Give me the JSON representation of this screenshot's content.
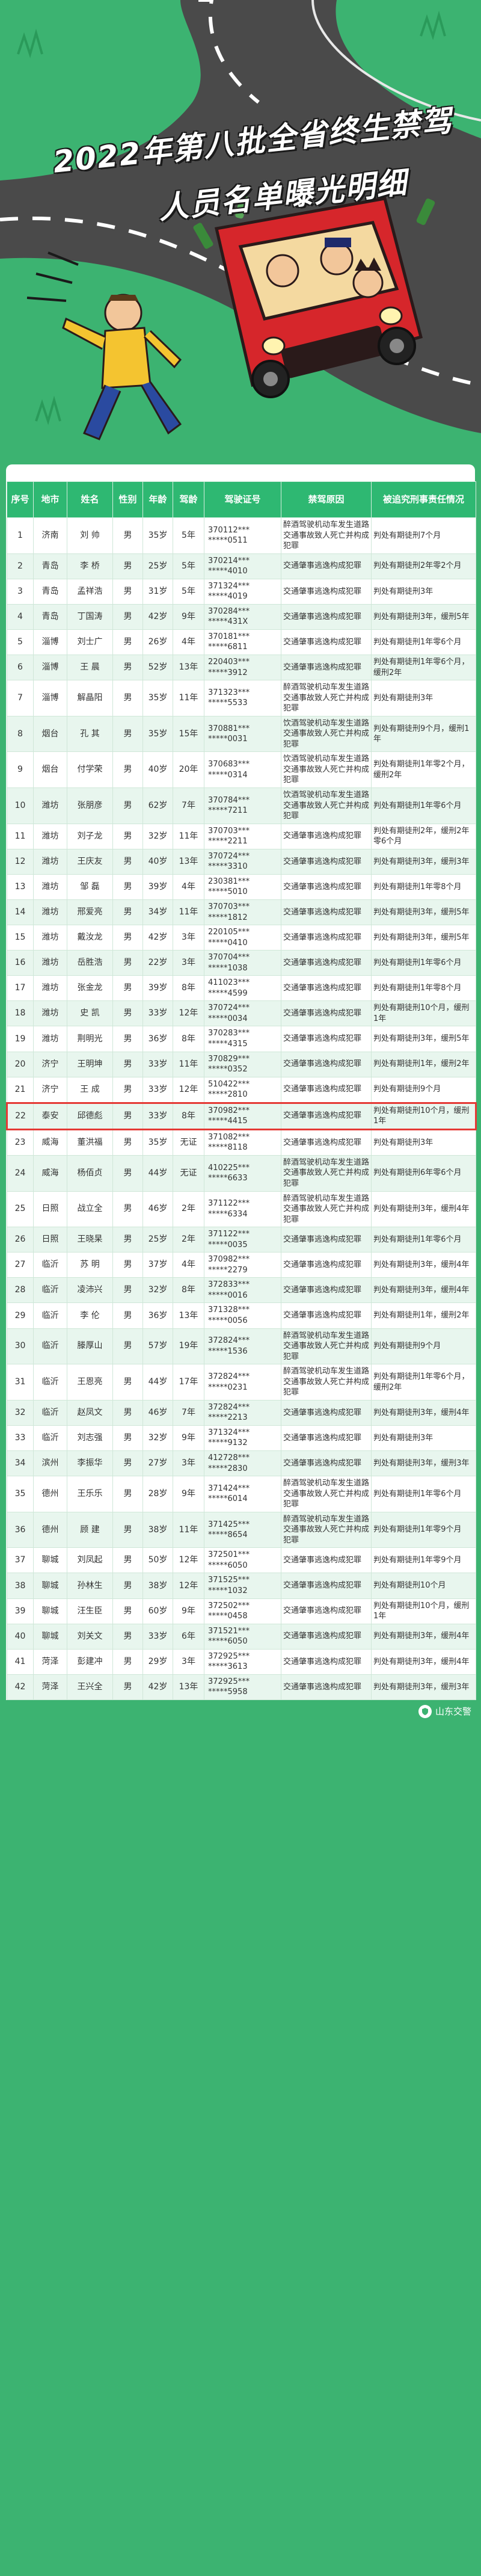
{
  "banner": {
    "title_line1": "2022年第八批全省终生禁驾",
    "title_line2": "人员名单曝光明细"
  },
  "table": {
    "headers": [
      "序号",
      "地市",
      "姓名",
      "性别",
      "年龄",
      "驾龄",
      "驾驶证号",
      "禁驾原因",
      "被追究刑事责任情况"
    ],
    "rows": [
      [
        "1",
        "济南",
        "刘 帅",
        "男",
        "35岁",
        "5年",
        "370112*** *****0511",
        "醉酒驾驶机动车发生道路交通事故致人死亡并构成犯罪",
        "判处有期徒刑7个月"
      ],
      [
        "2",
        "青岛",
        "李 桥",
        "男",
        "25岁",
        "5年",
        "370214*** *****4010",
        "交通肇事逃逸构成犯罪",
        "判处有期徒刑2年零2个月"
      ],
      [
        "3",
        "青岛",
        "孟祥浩",
        "男",
        "31岁",
        "5年",
        "371324*** *****4019",
        "交通肇事逃逸构成犯罪",
        "判处有期徒刑3年"
      ],
      [
        "4",
        "青岛",
        "丁国涛",
        "男",
        "42岁",
        "9年",
        "370284*** *****431X",
        "交通肇事逃逸构成犯罪",
        "判处有期徒刑3年，缓刑5年"
      ],
      [
        "5",
        "淄博",
        "刘士广",
        "男",
        "26岁",
        "4年",
        "370181*** *****6811",
        "交通肇事逃逸构成犯罪",
        "判处有期徒刑1年零6个月"
      ],
      [
        "6",
        "淄博",
        "王 晨",
        "男",
        "52岁",
        "13年",
        "220403*** *****3912",
        "交通肇事逃逸构成犯罪",
        "判处有期徒刑1年零6个月，缓刑2年"
      ],
      [
        "7",
        "淄博",
        "解晶阳",
        "男",
        "35岁",
        "11年",
        "371323*** *****5533",
        "醉酒驾驶机动车发生道路交通事故致人死亡并构成犯罪",
        "判处有期徒刑3年"
      ],
      [
        "8",
        "烟台",
        "孔 其",
        "男",
        "35岁",
        "15年",
        "370881*** *****0031",
        "饮酒驾驶机动车发生道路交通事故致人死亡并构成犯罪",
        "判处有期徒刑9个月，缓刑1年"
      ],
      [
        "9",
        "烟台",
        "付学荣",
        "男",
        "40岁",
        "20年",
        "370683*** *****0314",
        "饮酒驾驶机动车发生道路交通事故致人死亡并构成犯罪",
        "判处有期徒刑1年零2个月，缓刑2年"
      ],
      [
        "10",
        "潍坊",
        "张朋彦",
        "男",
        "62岁",
        "7年",
        "370784*** *****7211",
        "饮酒驾驶机动车发生道路交通事故致人死亡并构成犯罪",
        "判处有期徒刑1年零6个月"
      ],
      [
        "11",
        "潍坊",
        "刘子龙",
        "男",
        "32岁",
        "11年",
        "370703*** *****2211",
        "交通肇事逃逸构成犯罪",
        "判处有期徒刑2年，缓刑2年零6个月"
      ],
      [
        "12",
        "潍坊",
        "王庆友",
        "男",
        "40岁",
        "13年",
        "370724*** *****3310",
        "交通肇事逃逸构成犯罪",
        "判处有期徒刑3年，缓刑3年"
      ],
      [
        "13",
        "潍坊",
        "邹 磊",
        "男",
        "39岁",
        "4年",
        "230381*** *****5010",
        "交通肇事逃逸构成犯罪",
        "判处有期徒刑1年零8个月"
      ],
      [
        "14",
        "潍坊",
        "邢爱亮",
        "男",
        "34岁",
        "11年",
        "370703*** *****1812",
        "交通肇事逃逸构成犯罪",
        "判处有期徒刑3年，缓刑5年"
      ],
      [
        "15",
        "潍坊",
        "戴汝龙",
        "男",
        "42岁",
        "3年",
        "220105*** *****0410",
        "交通肇事逃逸构成犯罪",
        "判处有期徒刑3年，缓刑5年"
      ],
      [
        "16",
        "潍坊",
        "岳胜浩",
        "男",
        "22岁",
        "3年",
        "370704*** *****1038",
        "交通肇事逃逸构成犯罪",
        "判处有期徒刑1年零6个月"
      ],
      [
        "17",
        "潍坊",
        "张金龙",
        "男",
        "39岁",
        "8年",
        "411023*** *****4599",
        "交通肇事逃逸构成犯罪",
        "判处有期徒刑1年零8个月"
      ],
      [
        "18",
        "潍坊",
        "史 凯",
        "男",
        "33岁",
        "12年",
        "370724*** *****0034",
        "交通肇事逃逸构成犯罪",
        "判处有期徒刑10个月，缓刑1年"
      ],
      [
        "19",
        "潍坊",
        "荆明光",
        "男",
        "36岁",
        "8年",
        "370283*** *****4315",
        "交通肇事逃逸构成犯罪",
        "判处有期徒刑3年，缓刑5年"
      ],
      [
        "20",
        "济宁",
        "王明坤",
        "男",
        "33岁",
        "11年",
        "370829*** *****0352",
        "交通肇事逃逸构成犯罪",
        "判处有期徒刑1年，缓刑2年"
      ],
      [
        "21",
        "济宁",
        "王 成",
        "男",
        "33岁",
        "12年",
        "510422*** *****2810",
        "交通肇事逃逸构成犯罪",
        "判处有期徒刑9个月"
      ],
      [
        "22",
        "泰安",
        "邱德彪",
        "男",
        "33岁",
        "8年",
        "370982*** *****4415",
        "交通肇事逃逸构成犯罪",
        "判处有期徒刑10个月，缓刑1年"
      ],
      [
        "23",
        "威海",
        "董洪福",
        "男",
        "35岁",
        "无证",
        "371082*** *****8118",
        "交通肇事逃逸构成犯罪",
        "判处有期徒刑3年"
      ],
      [
        "24",
        "威海",
        "杨佰贞",
        "男",
        "44岁",
        "无证",
        "410225*** *****6633",
        "醉酒驾驶机动车发生道路交通事故致人死亡并构成犯罪",
        "判处有期徒刑6年零6个月"
      ],
      [
        "25",
        "日照",
        "战立全",
        "男",
        "46岁",
        "2年",
        "371122*** *****6334",
        "醉酒驾驶机动车发生道路交通事故致人死亡并构成犯罪",
        "判处有期徒刑3年，缓刑4年"
      ],
      [
        "26",
        "日照",
        "王晓杲",
        "男",
        "25岁",
        "2年",
        "371122*** *****0035",
        "交通肇事逃逸构成犯罪",
        "判处有期徒刑1年零6个月"
      ],
      [
        "27",
        "临沂",
        "苏 明",
        "男",
        "37岁",
        "4年",
        "370982*** *****2279",
        "交通肇事逃逸构成犯罪",
        "判处有期徒刑3年，缓刑4年"
      ],
      [
        "28",
        "临沂",
        "凌沛兴",
        "男",
        "32岁",
        "8年",
        "372833*** *****0016",
        "交通肇事逃逸构成犯罪",
        "判处有期徒刑3年，缓刑4年"
      ],
      [
        "29",
        "临沂",
        "李 伦",
        "男",
        "36岁",
        "13年",
        "371328*** *****0056",
        "交通肇事逃逸构成犯罪",
        "判处有期徒刑1年，缓刑2年"
      ],
      [
        "30",
        "临沂",
        "滕厚山",
        "男",
        "57岁",
        "19年",
        "372824*** *****1536",
        "醉酒驾驶机动车发生道路交通事故致人死亡并构成犯罪",
        "判处有期徒刑9个月"
      ],
      [
        "31",
        "临沂",
        "王恩亮",
        "男",
        "44岁",
        "17年",
        "372824*** *****0231",
        "醉酒驾驶机动车发生道路交通事故致人死亡并构成犯罪",
        "判处有期徒刑1年零6个月，缓刑2年"
      ],
      [
        "32",
        "临沂",
        "赵凤文",
        "男",
        "46岁",
        "7年",
        "372824*** *****2213",
        "交通肇事逃逸构成犯罪",
        "判处有期徒刑3年，缓刑4年"
      ],
      [
        "33",
        "临沂",
        "刘志强",
        "男",
        "32岁",
        "9年",
        "371324*** *****9132",
        "交通肇事逃逸构成犯罪",
        "判处有期徒刑3年"
      ],
      [
        "34",
        "滨州",
        "李振华",
        "男",
        "27岁",
        "3年",
        "412728*** *****2830",
        "交通肇事逃逸构成犯罪",
        "判处有期徒刑3年，缓刑3年"
      ],
      [
        "35",
        "德州",
        "王乐乐",
        "男",
        "28岁",
        "9年",
        "371424*** *****6014",
        "醉酒驾驶机动车发生道路交通事故致人死亡并构成犯罪",
        "判处有期徒刑1年零6个月"
      ],
      [
        "36",
        "德州",
        "顾 建",
        "男",
        "38岁",
        "11年",
        "371425*** *****8654",
        "醉酒驾驶机动车发生道路交通事故致人死亡并构成犯罪",
        "判处有期徒刑1年零9个月"
      ],
      [
        "37",
        "聊城",
        "刘凤起",
        "男",
        "50岁",
        "12年",
        "372501*** *****6050",
        "交通肇事逃逸构成犯罪",
        "判处有期徒刑1年零9个月"
      ],
      [
        "38",
        "聊城",
        "孙林生",
        "男",
        "38岁",
        "12年",
        "371525*** *****1032",
        "交通肇事逃逸构成犯罪",
        "判处有期徒刑10个月"
      ],
      [
        "39",
        "聊城",
        "汪生臣",
        "男",
        "60岁",
        "9年",
        "372502*** *****0458",
        "交通肇事逃逸构成犯罪",
        "判处有期徒刑10个月，缓刑1年"
      ],
      [
        "40",
        "聊城",
        "刘关文",
        "男",
        "33岁",
        "6年",
        "371521*** *****6050",
        "交通肇事逃逸构成犯罪",
        "判处有期徒刑3年，缓刑4年"
      ],
      [
        "41",
        "菏泽",
        "彭建冲",
        "男",
        "29岁",
        "3年",
        "372925*** *****3613",
        "交通肇事逃逸构成犯罪",
        "判处有期徒刑3年，缓刑4年"
      ],
      [
        "42",
        "菏泽",
        "王兴全",
        "男",
        "42岁",
        "13年",
        "372925*** *****5958",
        "交通肇事逃逸构成犯罪",
        "判处有期徒刑3年，缓刑3年"
      ]
    ],
    "highlight_row": "22"
  },
  "footer": {
    "watermark": "山东交警"
  },
  "colors": {
    "background": "#3cb371",
    "header": "#2eb872",
    "highlight_border": "#e53935"
  }
}
